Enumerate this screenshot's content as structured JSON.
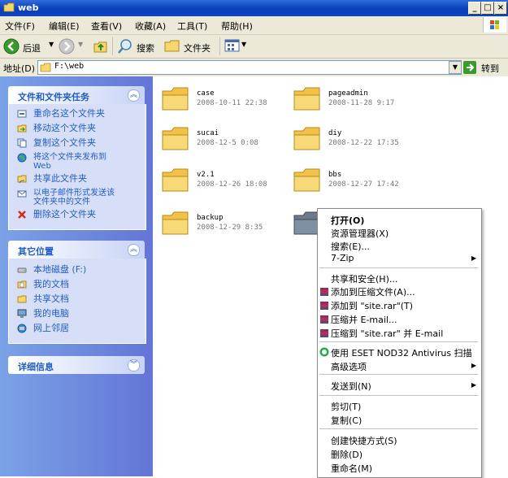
{
  "window": {
    "title": "web"
  },
  "menubar": {
    "items": [
      "文件(F)",
      "编辑(E)",
      "查看(V)",
      "收藏(A)",
      "工具(T)",
      "帮助(H)"
    ]
  },
  "toolbar": {
    "back": "后退",
    "search": "搜索",
    "folders": "文件夹"
  },
  "address": {
    "label": "地址(D)",
    "path": "F:\\web",
    "go": "转到"
  },
  "tasks": {
    "title": "文件和文件夹任务",
    "items": [
      "重命名这个文件夹",
      "移动这个文件夹",
      "复制这个文件夹",
      "将这个文件夹发布到\nWeb",
      "共享此文件夹",
      "以电子邮件形式发送该\n文件夹中的文件",
      "删除这个文件夹"
    ]
  },
  "places": {
    "title": "其它位置",
    "items": [
      "本地磁盘 (F:)",
      "我的文档",
      "共享文档",
      "我的电脑",
      "网上邻居"
    ]
  },
  "details": {
    "title": "详细信息"
  },
  "files": [
    {
      "name": "case",
      "date": "2008-10-11 22:38"
    },
    {
      "name": "pageadmin",
      "date": "2008-11-28 9:17"
    },
    {
      "name": "sucai",
      "date": "2008-12-5 0:08"
    },
    {
      "name": "diy",
      "date": "2008-12-22 17:35"
    },
    {
      "name": "v2.1",
      "date": "2008-12-26 18:08"
    },
    {
      "name": "bbs",
      "date": "2008-12-27 17:42"
    },
    {
      "name": "backup",
      "date": "2008-12-29 8:35"
    }
  ],
  "context_menu": {
    "open": "打开(O)",
    "explorer": "资源管理器(X)",
    "search": "搜索(E)...",
    "zip": "7-Zip",
    "share": "共享和安全(H)...",
    "rar_add": "添加到压缩文件(A)...",
    "rar_add_site": "添加到 \"site.rar\"(T)",
    "rar_email": "压缩并 E-mail...",
    "rar_email_site": "压缩到 \"site.rar\" 并 E-mail",
    "eset": "使用 ESET NOD32 Antivirus 扫描",
    "advanced": "高级选项",
    "sendto": "发送到(N)",
    "cut": "剪切(T)",
    "copy": "复制(C)",
    "shortcut": "创建快捷方式(S)",
    "delete": "删除(D)",
    "rename": "重命名(M)"
  }
}
